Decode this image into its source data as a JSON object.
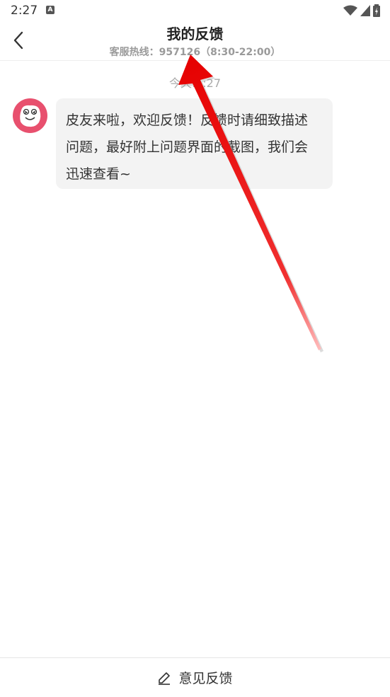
{
  "status_bar": {
    "time": "2:27",
    "icons": [
      "a-notification-icon",
      "wifi-icon",
      "signal-icon",
      "battery-charging-icon"
    ]
  },
  "header": {
    "title": "我的反馈",
    "hotline": "客服热线：957126（8:30-22:00）"
  },
  "chat": {
    "timestamp": "今天1 :27",
    "messages": [
      {
        "sender_icon": "pipi-avatar-icon",
        "lines": [
          "皮友来啦，欢迎反馈！反馈时请细致描述",
          "问题，最好附上问题界面的截图，我们会",
          "迅速查看~"
        ]
      }
    ]
  },
  "footer": {
    "button_label": "意见反馈",
    "icon": "edit-icon"
  },
  "colors": {
    "annotation_arrow": "#ee0000",
    "avatar_bg": "#e8506e",
    "bubble_bg": "#f3f3f3"
  }
}
